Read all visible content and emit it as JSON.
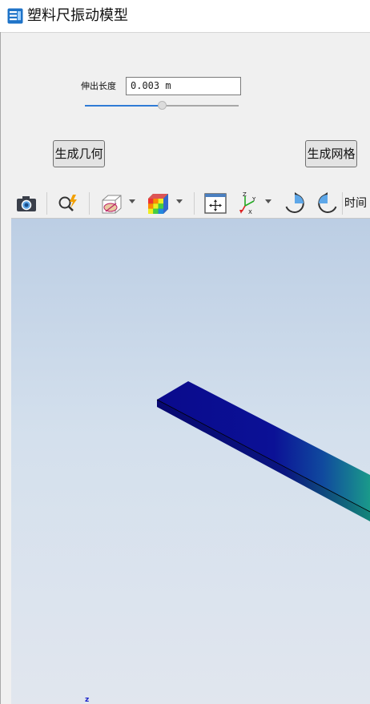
{
  "window": {
    "title": "塑料尺振动模型",
    "icon": "app-icon"
  },
  "parameters": {
    "length_label": "伸出长度",
    "length_value": "0.003 m",
    "length_slider_fraction": 0.5
  },
  "buttons": {
    "build_geometry": "生成几何",
    "build_mesh": "生成网格"
  },
  "toolbar": {
    "items": [
      "camera-icon",
      "zoom-lightning-icon",
      "transparency-icon",
      "color-cube-icon",
      "zoom-extents-icon",
      "axes-orientation-icon",
      "rotate-left-icon",
      "rotate-right-icon"
    ],
    "time_label": "时间"
  },
  "viewport": {
    "axis_label": "z",
    "colors": {
      "beam_low": "#0a0a8c",
      "beam_high": "#1a9a8a",
      "background_top": "#bccee4",
      "background_bottom": "#e1e6ee"
    }
  }
}
